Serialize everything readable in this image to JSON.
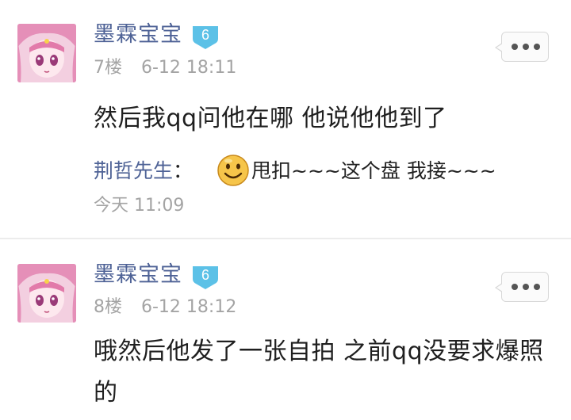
{
  "posts": [
    {
      "username": "墨霖宝宝",
      "level": "6",
      "floor": "7楼",
      "time": "6-12 18:11",
      "content": "然后我qq问他在哪 他说他他到了",
      "reply": {
        "user": "荆哲先生",
        "separator": "：",
        "emoji": "smile-emoji-icon",
        "text": "甩扣~~~这个盘 我接~~~",
        "time": "今天 11:09"
      }
    },
    {
      "username": "墨霖宝宝",
      "level": "6",
      "floor": "8楼",
      "time": "6-12 18:12",
      "content": "哦然后他发了一张自拍 之前qq没要求爆照的"
    }
  ],
  "colors": {
    "username": "#4e6296",
    "meta": "#a4a4a4",
    "badge": "#5cc1e7",
    "text": "#1f1f1f"
  },
  "icons": {
    "more": "more-dots-icon",
    "level": "level-badge-icon",
    "avatar": "anime-girl-avatar"
  }
}
